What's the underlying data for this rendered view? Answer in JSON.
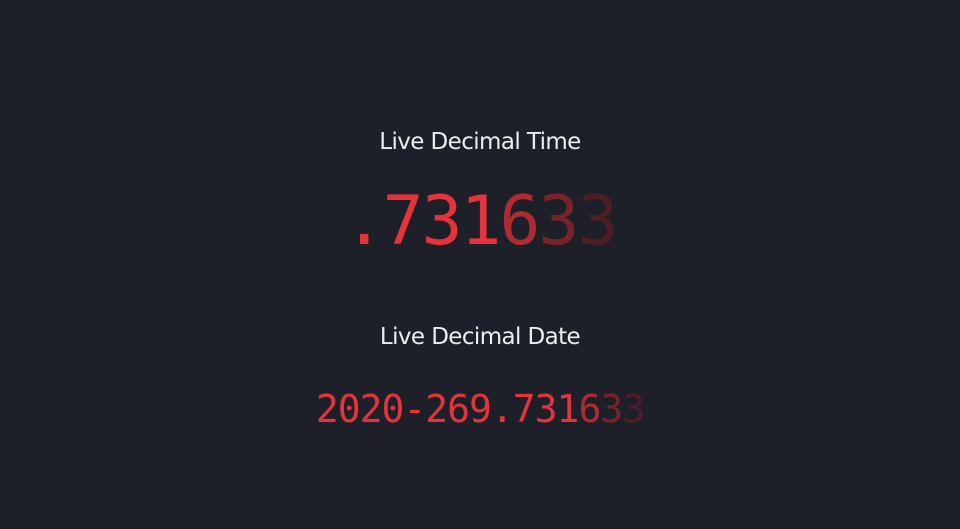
{
  "decimal_time": {
    "heading": "Live Decimal Time",
    "value_bright": ".731",
    "value_fade": [
      "6",
      "3",
      "3"
    ]
  },
  "decimal_date": {
    "heading": "Live Decimal Date",
    "value_bright": "2020-269.731",
    "value_fade": [
      "6",
      "3",
      "3"
    ]
  },
  "colors": {
    "background": "#1e2029",
    "heading_text": "#ecedf0",
    "digit_bright": "#e4343a",
    "digit_fade_1": "#b02a31",
    "digit_fade_2": "#7a2229",
    "digit_fade_3": "#4f1d24"
  }
}
